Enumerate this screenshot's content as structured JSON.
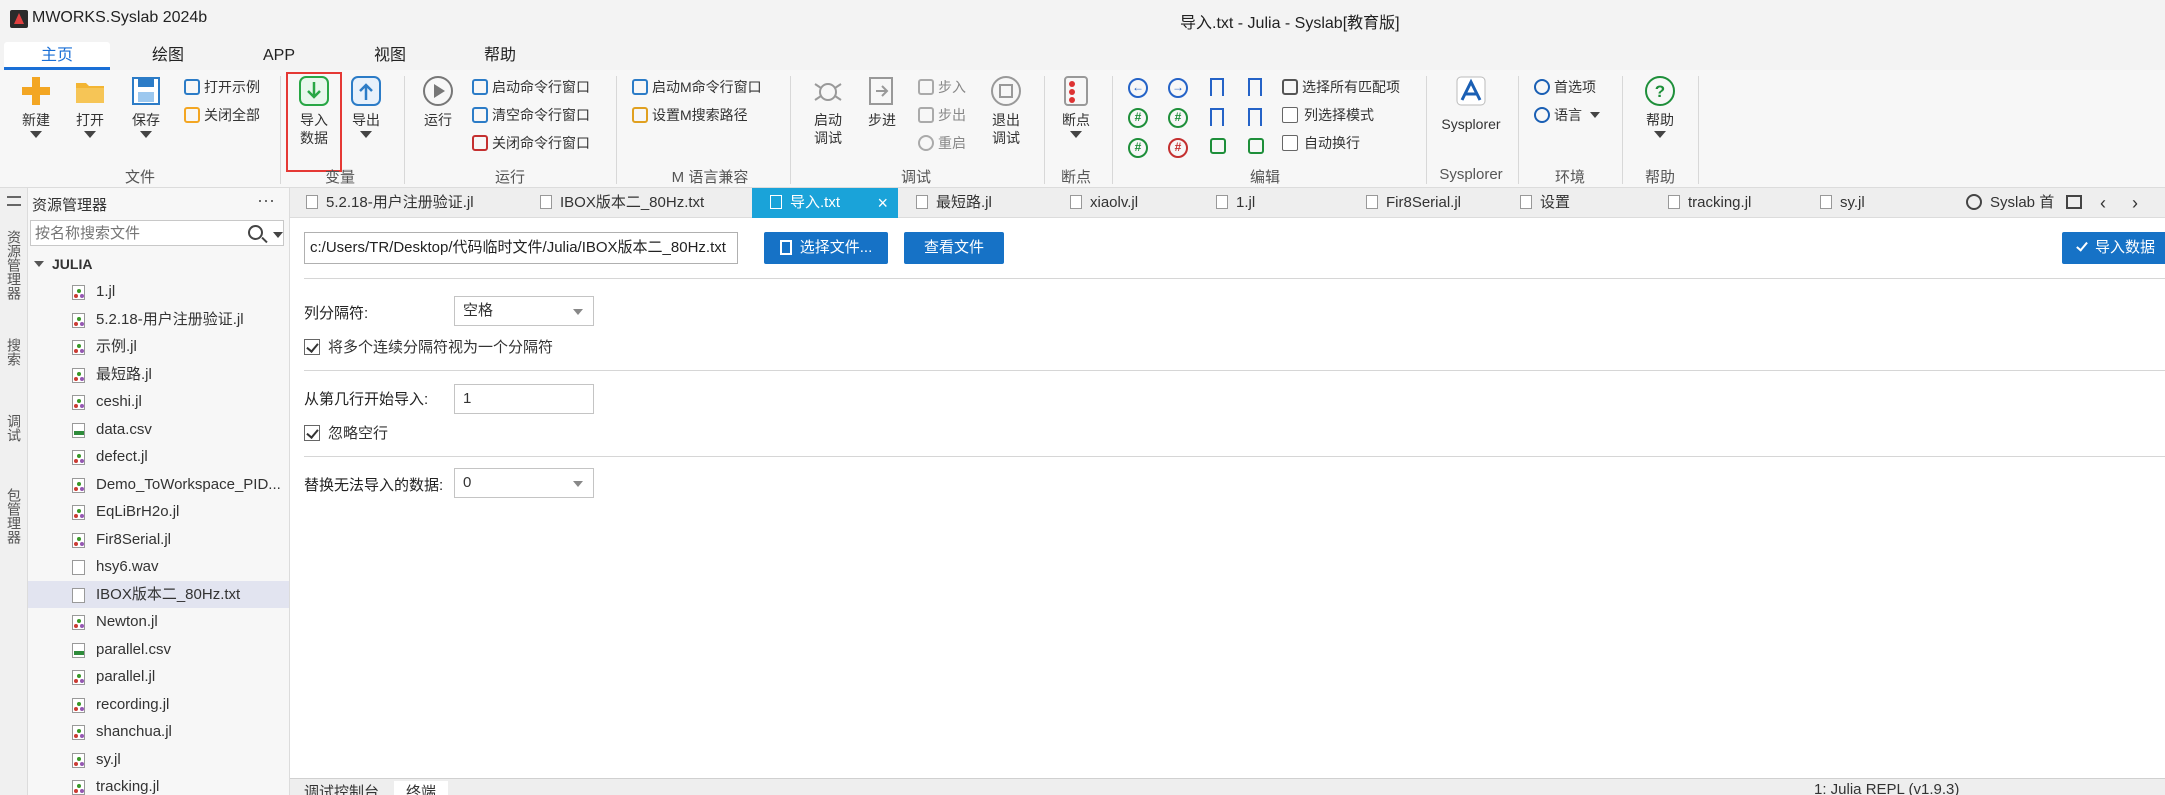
{
  "app": {
    "name": "MWORKS.Syslab 2024b",
    "window_title": "导入.txt - Julia - Syslab[教育版]"
  },
  "ribbon_tabs": [
    "主页",
    "绘图",
    "APP",
    "视图",
    "帮助"
  ],
  "ribbon": {
    "file": {
      "new": "新建",
      "open": "打开",
      "save": "保存",
      "open_example": "打开示例",
      "close_all": "关闭全部",
      "group": "文件"
    },
    "variable": {
      "import_line1": "导入",
      "import_line2": "数据",
      "export": "导出",
      "group": "变量"
    },
    "run": {
      "run": "运行",
      "start_cmd": "启动命令行窗口",
      "clear_cmd": "清空命令行窗口",
      "close_cmd": "关闭命令行窗口",
      "group": "运行"
    },
    "mlang": {
      "start_m": "启动M命令行窗口",
      "set_m_path": "设置M搜索路径",
      "group": "M 语言兼容"
    },
    "debug": {
      "start_line1": "启动",
      "start_line2": "调试",
      "step": "步进",
      "step_in": "步入",
      "step_out": "步出",
      "restart": "重启",
      "exit_line1": "退出",
      "exit_line2": "调试",
      "group": "调试"
    },
    "breakpoint": {
      "label": "断点",
      "group": "断点"
    },
    "edit": {
      "select_all_matches": "选择所有匹配项",
      "column_mode": "列选择模式",
      "word_wrap": "自动换行",
      "group": "编辑"
    },
    "sysplorer": {
      "label": "Sysplorer",
      "group": "Sysplorer"
    },
    "env": {
      "preferences": "首选项",
      "language": "语言",
      "group": "环境"
    },
    "help": {
      "label": "帮助",
      "group": "帮助"
    }
  },
  "side_strip": [
    "资源管理器",
    "搜索",
    "调试",
    "包管理器"
  ],
  "explorer": {
    "title": "资源管理器",
    "more": "···",
    "search_placeholder": "按名称搜索文件",
    "root": "JULIA",
    "files": [
      {
        "name": "1.jl",
        "type": "jl"
      },
      {
        "name": "5.2.18-用户注册验证.jl",
        "type": "jl"
      },
      {
        "name": "示例.jl",
        "type": "jl"
      },
      {
        "name": "最短路.jl",
        "type": "jl"
      },
      {
        "name": "ceshi.jl",
        "type": "jl"
      },
      {
        "name": "data.csv",
        "type": "csv"
      },
      {
        "name": "defect.jl",
        "type": "jl"
      },
      {
        "name": "Demo_ToWorkspace_PID...",
        "type": "jl"
      },
      {
        "name": "EqLiBrH2o.jl",
        "type": "jl"
      },
      {
        "name": "Fir8Serial.jl",
        "type": "jl"
      },
      {
        "name": "hsy6.wav",
        "type": "file"
      },
      {
        "name": "IBOX版本二_80Hz.txt",
        "type": "file",
        "selected": true
      },
      {
        "name": "Newton.jl",
        "type": "jl"
      },
      {
        "name": "parallel.csv",
        "type": "csv"
      },
      {
        "name": "parallel.jl",
        "type": "jl"
      },
      {
        "name": "recording.jl",
        "type": "jl"
      },
      {
        "name": "shanchua.jl",
        "type": "jl"
      },
      {
        "name": "sy.jl",
        "type": "jl"
      },
      {
        "name": "tracking.jl",
        "type": "jl"
      }
    ]
  },
  "editor_tabs": [
    "5.2.18-用户注册验证.jl",
    "IBOX版本二_80Hz.txt",
    "导入.txt",
    "最短路.jl",
    "xiaolv.jl",
    "1.jl",
    "Fir8Serial.jl",
    "设置",
    "tracking.jl",
    "sy.jl"
  ],
  "editor_tab_overflow": "Syslab 首",
  "import_panel": {
    "file_path": "c:/Users/TR/Desktop/代码临时文件/Julia/IBOX版本二_80Hz.txt",
    "select_file_btn": "选择文件...",
    "view_file_btn": "查看文件",
    "import_btn": "导入数据",
    "delimiter_label": "列分隔符:",
    "delimiter_value": "空格",
    "merge_delimiters": "将多个连续分隔符视为一个分隔符",
    "start_row_label": "从第几行开始导入:",
    "start_row_value": "1",
    "ignore_empty": "忽略空行",
    "replace_label": "替换无法导入的数据:",
    "replace_value": "0"
  },
  "bottom_tabs": [
    "调试控制台",
    "终端"
  ],
  "bottom_right": "1: Julia REPL (v1.9.3)"
}
